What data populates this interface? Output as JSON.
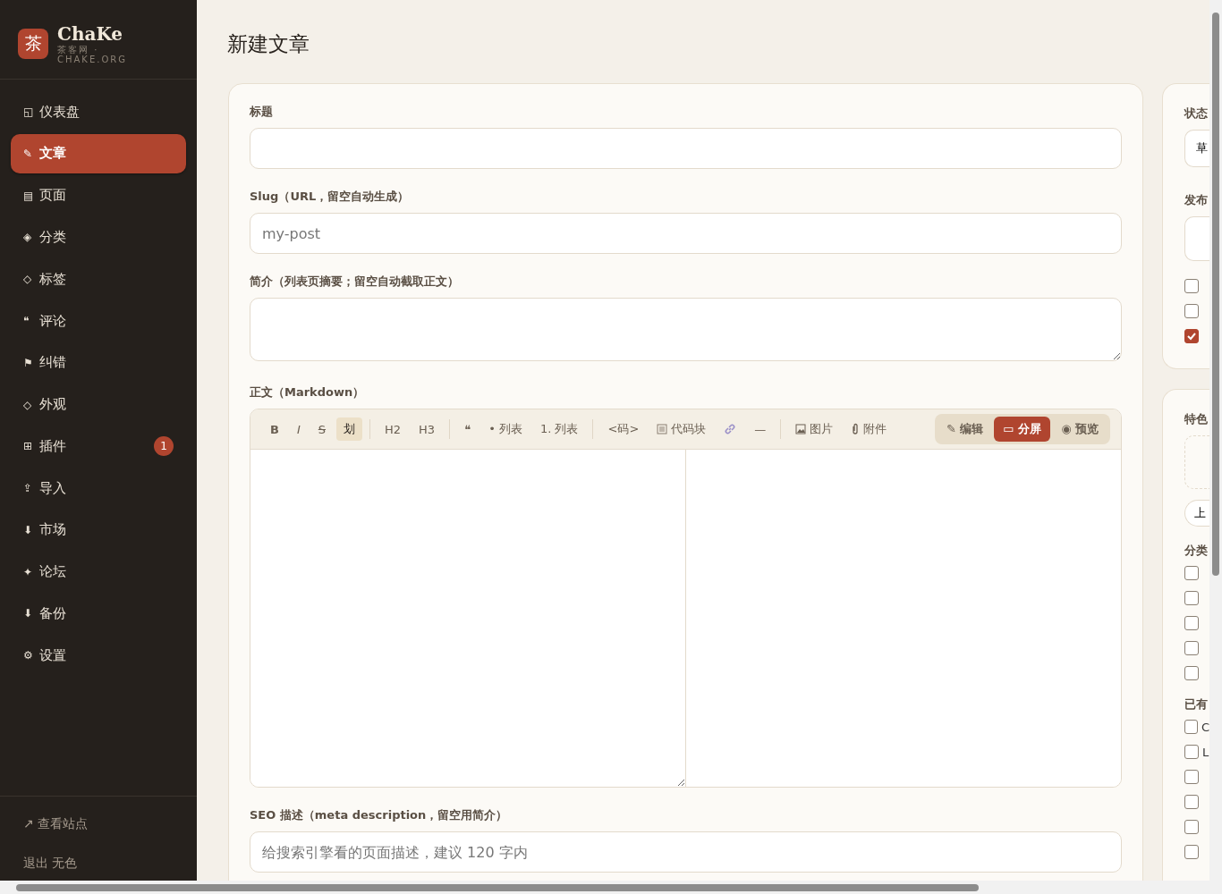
{
  "brand": {
    "logo": "茶",
    "name": "ChaKe",
    "tagline": "茶客网 · CHAKE.ORG"
  },
  "sidebar": {
    "items": [
      {
        "icon": "◱",
        "label": "仪表盘",
        "selected": false
      },
      {
        "icon": "✎",
        "label": "文章",
        "selected": true
      },
      {
        "icon": "▤",
        "label": "页面",
        "selected": false
      },
      {
        "icon": "◈",
        "label": "分类",
        "selected": false
      },
      {
        "icon": "◇",
        "label": "标签",
        "selected": false
      },
      {
        "icon": "❝",
        "label": "评论",
        "selected": false
      },
      {
        "icon": "⚑",
        "label": "纠错",
        "selected": false
      },
      {
        "icon": "◇",
        "label": "外观",
        "selected": false
      },
      {
        "icon": "⊞",
        "label": "插件",
        "selected": false,
        "badge": "1"
      },
      {
        "icon": "⇪",
        "label": "导入",
        "selected": false
      },
      {
        "icon": "⬇",
        "label": "市场",
        "selected": false
      },
      {
        "icon": "✦",
        "label": "论坛",
        "selected": false
      },
      {
        "icon": "⬇",
        "label": "备份",
        "selected": false
      },
      {
        "icon": "⚙",
        "label": "设置",
        "selected": false
      }
    ],
    "footer": [
      {
        "icon": "↗",
        "label": "查看站点"
      },
      {
        "label": "退出 无色"
      }
    ]
  },
  "page_title": "新建文章",
  "form": {
    "title_label": "标题",
    "slug_label": "Slug（URL，留空自动生成）",
    "slug_placeholder": "my-post",
    "summary_label": "简介（列表页摘要；留空自动截取正文）",
    "body_label": "正文（Markdown）",
    "toolbar": [
      {
        "kind": "bold",
        "label": "B",
        "active": false
      },
      {
        "kind": "italic",
        "label": "I",
        "active": false
      },
      {
        "kind": "strike",
        "label": "S",
        "active": false
      },
      {
        "kind": "text",
        "label": "划",
        "active": true
      },
      {
        "kind": "sep"
      },
      {
        "kind": "text",
        "label": "H2",
        "active": false
      },
      {
        "kind": "text",
        "label": "H3",
        "active": false
      },
      {
        "kind": "sep"
      },
      {
        "kind": "text",
        "label": "❝",
        "active": false
      },
      {
        "kind": "text",
        "label": "• 列表",
        "active": false
      },
      {
        "kind": "text",
        "label": "1. 列表",
        "active": false
      },
      {
        "kind": "sep"
      },
      {
        "kind": "text",
        "label": "<码>",
        "active": false
      },
      {
        "kind": "code",
        "label": "代码块"
      },
      {
        "kind": "link"
      },
      {
        "kind": "text",
        "label": "—",
        "active": false
      },
      {
        "kind": "sep"
      },
      {
        "kind": "image",
        "label": "图片"
      },
      {
        "kind": "clip",
        "label": "附件"
      }
    ],
    "view_modes": [
      {
        "icon": "✎",
        "label": "编辑",
        "selected": false
      },
      {
        "icon": "▭",
        "label": "分屏",
        "selected": true
      },
      {
        "icon": "◉",
        "label": "预览",
        "selected": false
      }
    ],
    "seo_label": "SEO 描述（meta description，留空用简介）",
    "seo_placeholder": "给搜索引擎看的页面描述，建议 120 字内"
  },
  "side_panel": {
    "status_label": "状态",
    "status_value": "草",
    "publish_label": "发布",
    "options": [
      {
        "checked": false
      },
      {
        "checked": false
      },
      {
        "checked": true
      }
    ],
    "featured_label": "特色",
    "upload_button": "上",
    "categories_label": "分类",
    "categories": [
      {
        "checked": false
      },
      {
        "checked": false
      },
      {
        "checked": false
      },
      {
        "checked": false
      },
      {
        "checked": false
      }
    ],
    "tags_label": "已有",
    "tags": [
      {
        "checked": false,
        "label": "C"
      },
      {
        "checked": false,
        "label": "L"
      },
      {
        "checked": false
      },
      {
        "checked": false
      },
      {
        "checked": false
      },
      {
        "checked": false
      }
    ]
  }
}
